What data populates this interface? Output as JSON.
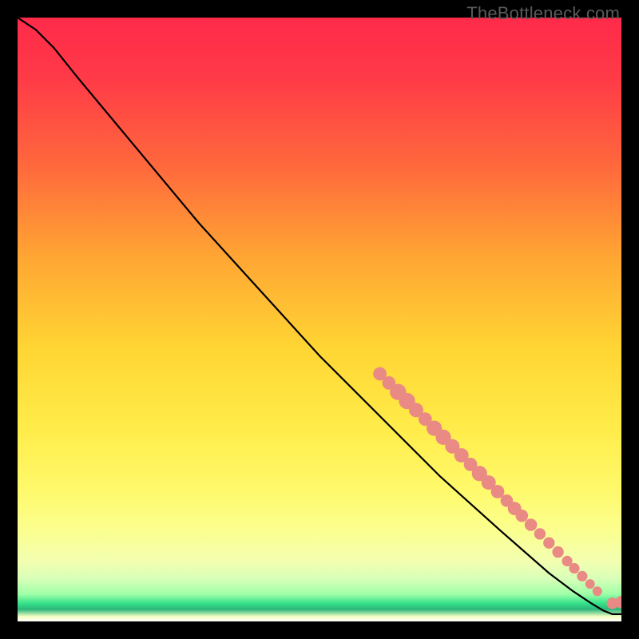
{
  "watermark": "TheBottleneck.com",
  "colors": {
    "dot": "#e98b84",
    "curve": "#000000",
    "frame_bg_top": "#ff2a4a",
    "frame_bg_bottom_accent": "#36e28a"
  },
  "chart_data": {
    "type": "line",
    "title": "",
    "xlabel": "",
    "ylabel": "",
    "xlim": [
      0,
      100
    ],
    "ylim": [
      0,
      100
    ],
    "grid": false,
    "series": [
      {
        "name": "curve",
        "x": [
          0,
          3,
          6,
          10,
          20,
          30,
          40,
          50,
          60,
          70,
          80,
          88,
          92,
          95,
          97,
          98.5,
          100
        ],
        "y": [
          100,
          98,
          95,
          90,
          78,
          66,
          55,
          44,
          34,
          24,
          15,
          8,
          5,
          3,
          1.8,
          1.2,
          1.2
        ]
      }
    ],
    "points": [
      {
        "x": 60.0,
        "y": 41.0,
        "r": 1.4
      },
      {
        "x": 61.5,
        "y": 39.5,
        "r": 1.4
      },
      {
        "x": 63.0,
        "y": 38.0,
        "r": 1.7
      },
      {
        "x": 64.5,
        "y": 36.5,
        "r": 1.7
      },
      {
        "x": 66.0,
        "y": 35.0,
        "r": 1.5
      },
      {
        "x": 67.5,
        "y": 33.5,
        "r": 1.4
      },
      {
        "x": 69.0,
        "y": 32.0,
        "r": 1.6
      },
      {
        "x": 70.5,
        "y": 30.5,
        "r": 1.6
      },
      {
        "x": 72.0,
        "y": 29.0,
        "r": 1.5
      },
      {
        "x": 73.5,
        "y": 27.5,
        "r": 1.5
      },
      {
        "x": 75.0,
        "y": 26.0,
        "r": 1.4
      },
      {
        "x": 76.5,
        "y": 24.5,
        "r": 1.6
      },
      {
        "x": 78.0,
        "y": 23.0,
        "r": 1.5
      },
      {
        "x": 79.5,
        "y": 21.5,
        "r": 1.4
      },
      {
        "x": 81.0,
        "y": 20.0,
        "r": 1.3
      },
      {
        "x": 82.3,
        "y": 18.7,
        "r": 1.4
      },
      {
        "x": 83.5,
        "y": 17.5,
        "r": 1.3
      },
      {
        "x": 85.0,
        "y": 16.0,
        "r": 1.3
      },
      {
        "x": 86.5,
        "y": 14.5,
        "r": 1.2
      },
      {
        "x": 88.0,
        "y": 13.0,
        "r": 1.2
      },
      {
        "x": 89.5,
        "y": 11.5,
        "r": 1.2
      },
      {
        "x": 91.0,
        "y": 10.0,
        "r": 1.1
      },
      {
        "x": 92.2,
        "y": 8.8,
        "r": 1.1
      },
      {
        "x": 93.5,
        "y": 7.5,
        "r": 1.1
      },
      {
        "x": 94.8,
        "y": 6.2,
        "r": 1.0
      },
      {
        "x": 96.0,
        "y": 5.0,
        "r": 1.0
      },
      {
        "x": 98.5,
        "y": 3.0,
        "r": 1.2
      },
      {
        "x": 100.0,
        "y": 3.2,
        "r": 1.3
      }
    ]
  }
}
